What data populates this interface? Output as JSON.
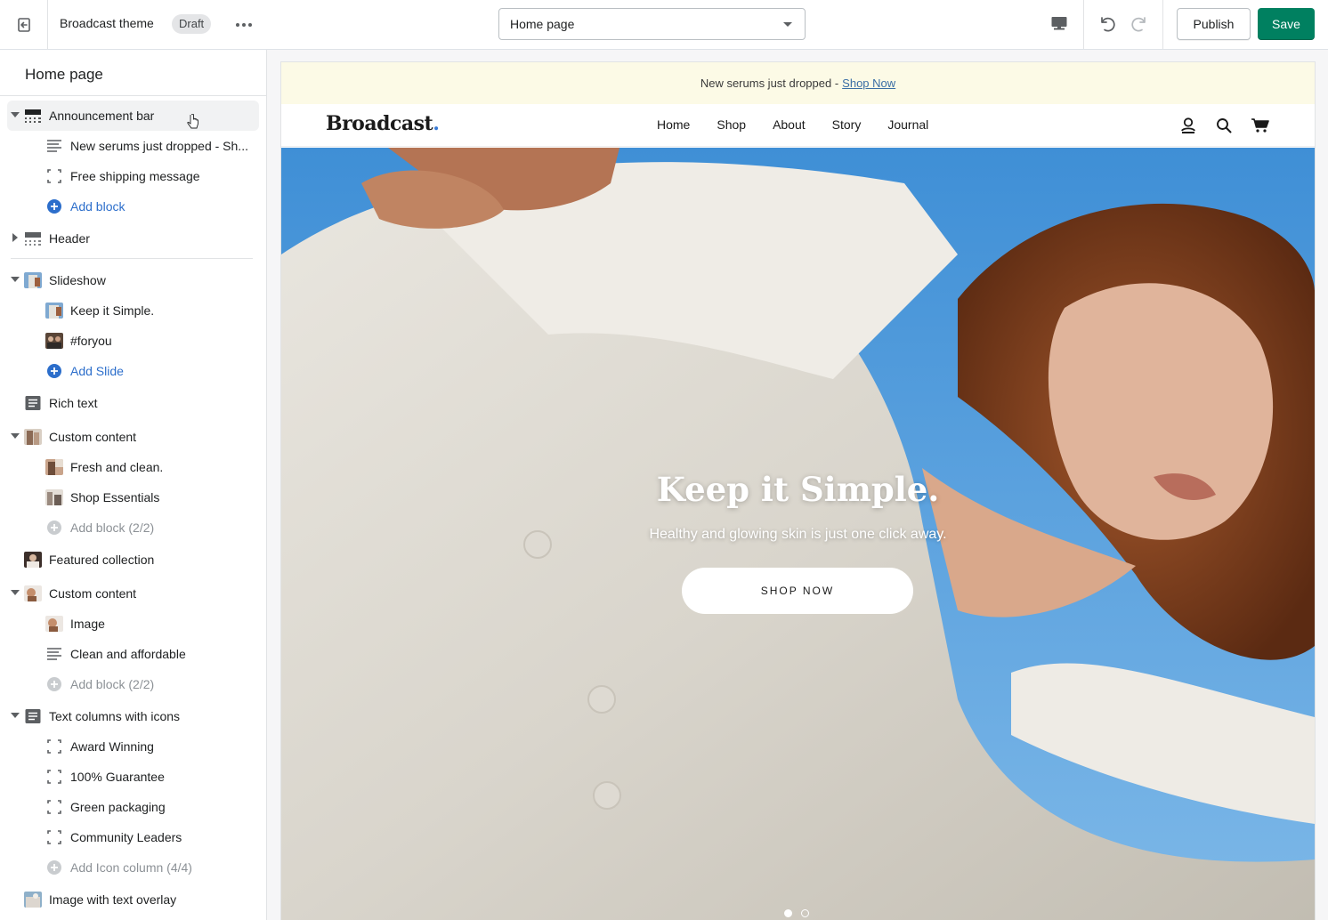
{
  "topbar": {
    "theme_name": "Broadcast theme",
    "status_badge": "Draft",
    "page_select": "Home page",
    "publish_label": "Publish",
    "save_label": "Save",
    "accent_color": "#008060"
  },
  "sidebar": {
    "title": "Home page",
    "items": [
      {
        "label": "Announcement bar",
        "icon": "header-section-icon"
      },
      {
        "label": "New serums just dropped - Sh...",
        "icon": "text-lines-icon"
      },
      {
        "label": "Free shipping message",
        "icon": "block-frame-icon"
      },
      {
        "label": "Add block",
        "icon": "plus-circle-icon"
      },
      {
        "label": "Header",
        "icon": "header-section-icon"
      },
      {
        "label": "Slideshow",
        "icon": "image-thumbnail"
      },
      {
        "label": "Keep it Simple.",
        "icon": "image-thumbnail"
      },
      {
        "label": "#foryou",
        "icon": "image-thumbnail"
      },
      {
        "label": "Add Slide",
        "icon": "plus-circle-icon"
      },
      {
        "label": "Rich text",
        "icon": "text-block-icon"
      },
      {
        "label": "Custom content",
        "icon": "image-thumbnail"
      },
      {
        "label": "Fresh and clean.",
        "icon": "image-thumbnail"
      },
      {
        "label": "Shop Essentials",
        "icon": "image-thumbnail"
      },
      {
        "label": "Add block (2/2)",
        "icon": "plus-circle-icon"
      },
      {
        "label": "Featured collection",
        "icon": "image-thumbnail"
      },
      {
        "label": "Custom content",
        "icon": "image-thumbnail"
      },
      {
        "label": "Image",
        "icon": "image-thumbnail"
      },
      {
        "label": "Clean and affordable",
        "icon": "text-lines-icon"
      },
      {
        "label": "Add block (2/2)",
        "icon": "plus-circle-icon"
      },
      {
        "label": "Text columns with icons",
        "icon": "text-block-icon"
      },
      {
        "label": "Award Winning",
        "icon": "block-frame-icon"
      },
      {
        "label": "100% Guarantee",
        "icon": "block-frame-icon"
      },
      {
        "label": "Green packaging",
        "icon": "block-frame-icon"
      },
      {
        "label": "Community Leaders",
        "icon": "block-frame-icon"
      },
      {
        "label": "Add Icon column (4/4)",
        "icon": "plus-circle-icon"
      },
      {
        "label": "Image with text overlay",
        "icon": "image-thumbnail"
      }
    ]
  },
  "preview": {
    "announcement_text": "New serums just dropped -",
    "announcement_link": "Shop Now",
    "logo_text": "Broadcast",
    "logo_dot": ".",
    "nav": [
      "Home",
      "Shop",
      "About",
      "Story",
      "Journal"
    ],
    "hero_title": "Keep it Simple.",
    "hero_subtitle": "Healthy and glowing skin is just one click away.",
    "hero_button": "SHOP NOW",
    "slides_count": 2,
    "active_slide": 1
  }
}
